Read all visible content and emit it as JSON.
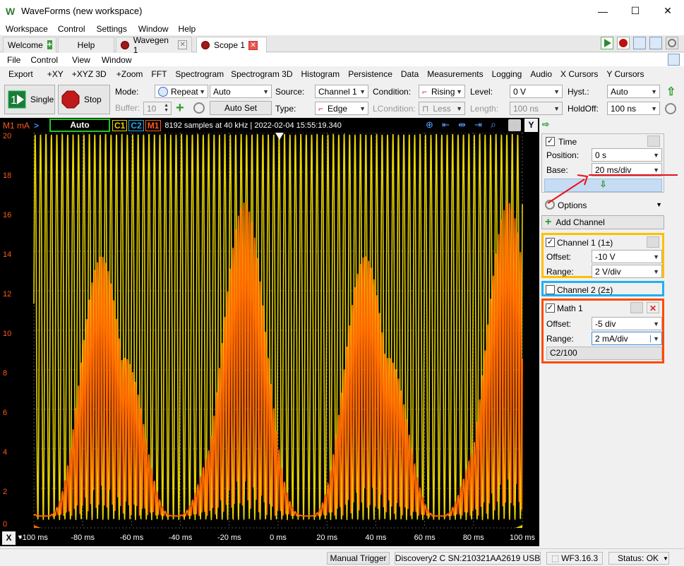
{
  "window": {
    "title": "WaveForms (new workspace)",
    "minimize": "—",
    "maximize": "☐",
    "close": "✕"
  },
  "menu": [
    "Workspace",
    "Control",
    "Settings",
    "Window",
    "Help"
  ],
  "tabs": [
    {
      "label": "Welcome"
    },
    {
      "label": "Help"
    },
    {
      "label": "Wavegen 1"
    },
    {
      "label": "Scope 1"
    }
  ],
  "scope_menu": [
    "File",
    "Control",
    "View",
    "Window"
  ],
  "toolbar": [
    "Export",
    "+XY",
    "+XYZ 3D",
    "+Zoom",
    "FFT",
    "Spectrogram",
    "Spectrogram 3D",
    "Histogram",
    "Persistence",
    "Data",
    "Measurements",
    "Logging",
    "Audio",
    "X Cursors",
    "Y Cursors"
  ],
  "controls": {
    "single": "Single",
    "stop": "Stop",
    "mode_label": "Mode:",
    "mode_value": "Repeat",
    "trigger_mode": "Auto",
    "buffer_label": "Buffer:",
    "buffer_value": "10",
    "autoset": "Auto Set",
    "source_label": "Source:",
    "source_value": "Channel 1",
    "type_label": "Type:",
    "type_value": "Edge",
    "condition_label": "Condition:",
    "condition_value": "Rising",
    "lcondition_label": "LCondition:",
    "lcondition_value": "Less",
    "level_label": "Level:",
    "level_value": "0 V",
    "length_label": "Length:",
    "length_value": "100 ns",
    "hyst_label": "Hyst.:",
    "hyst_value": "Auto",
    "holdoff_label": "HoldOff:",
    "holdoff_value": "100 ns"
  },
  "scope_header": {
    "axis_unit": "M1 mA",
    "status": "Auto",
    "c1": "C1",
    "c2": "C2",
    "m1": "M1",
    "info": "8192 samples at 40 kHz | 2022-02-04  15:55:19.340",
    "y_btn": "Y"
  },
  "chart_data": {
    "type": "line",
    "ylabel": "M1 mA",
    "y_ticks": [
      20,
      18,
      16,
      14,
      12,
      10,
      8,
      6,
      4,
      2,
      0
    ],
    "x_ticks": [
      "-100 ms",
      "-80 ms",
      "-60 ms",
      "-40 ms",
      "-20 ms",
      "0 ms",
      "20 ms",
      "40 ms",
      "60 ms",
      "80 ms",
      "100 ms"
    ],
    "xlim": [
      -100,
      100
    ],
    "ylim": [
      0,
      20
    ],
    "colors": {
      "channel1": "#e8d400",
      "math1": "#ff6a00",
      "grid": "#555555"
    }
  },
  "x_axis_btn": "X",
  "status": {
    "manual_trigger": "Manual Trigger",
    "device": "Discovery2 C SN:210321AA2619 USB",
    "version": "WF3.16.3",
    "state": "Status: OK"
  },
  "panel": {
    "time_title": "Time",
    "position_label": "Position:",
    "position_value": "0 s",
    "base_label": "Base:",
    "base_value": "20 ms/div",
    "options": "Options",
    "add_channel": "Add Channel",
    "ch1_title": "Channel 1 (1±)",
    "ch1_offset_label": "Offset:",
    "ch1_offset": "-10 V",
    "ch1_range_label": "Range:",
    "ch1_range": "2 V/div",
    "ch2_title": "Channel 2 (2±)",
    "math_title": "Math 1",
    "math_offset_label": "Offset:",
    "math_offset": "-5 div",
    "math_range_label": "Range:",
    "math_range": "2 mA/div",
    "math_expr": "C2/100"
  }
}
